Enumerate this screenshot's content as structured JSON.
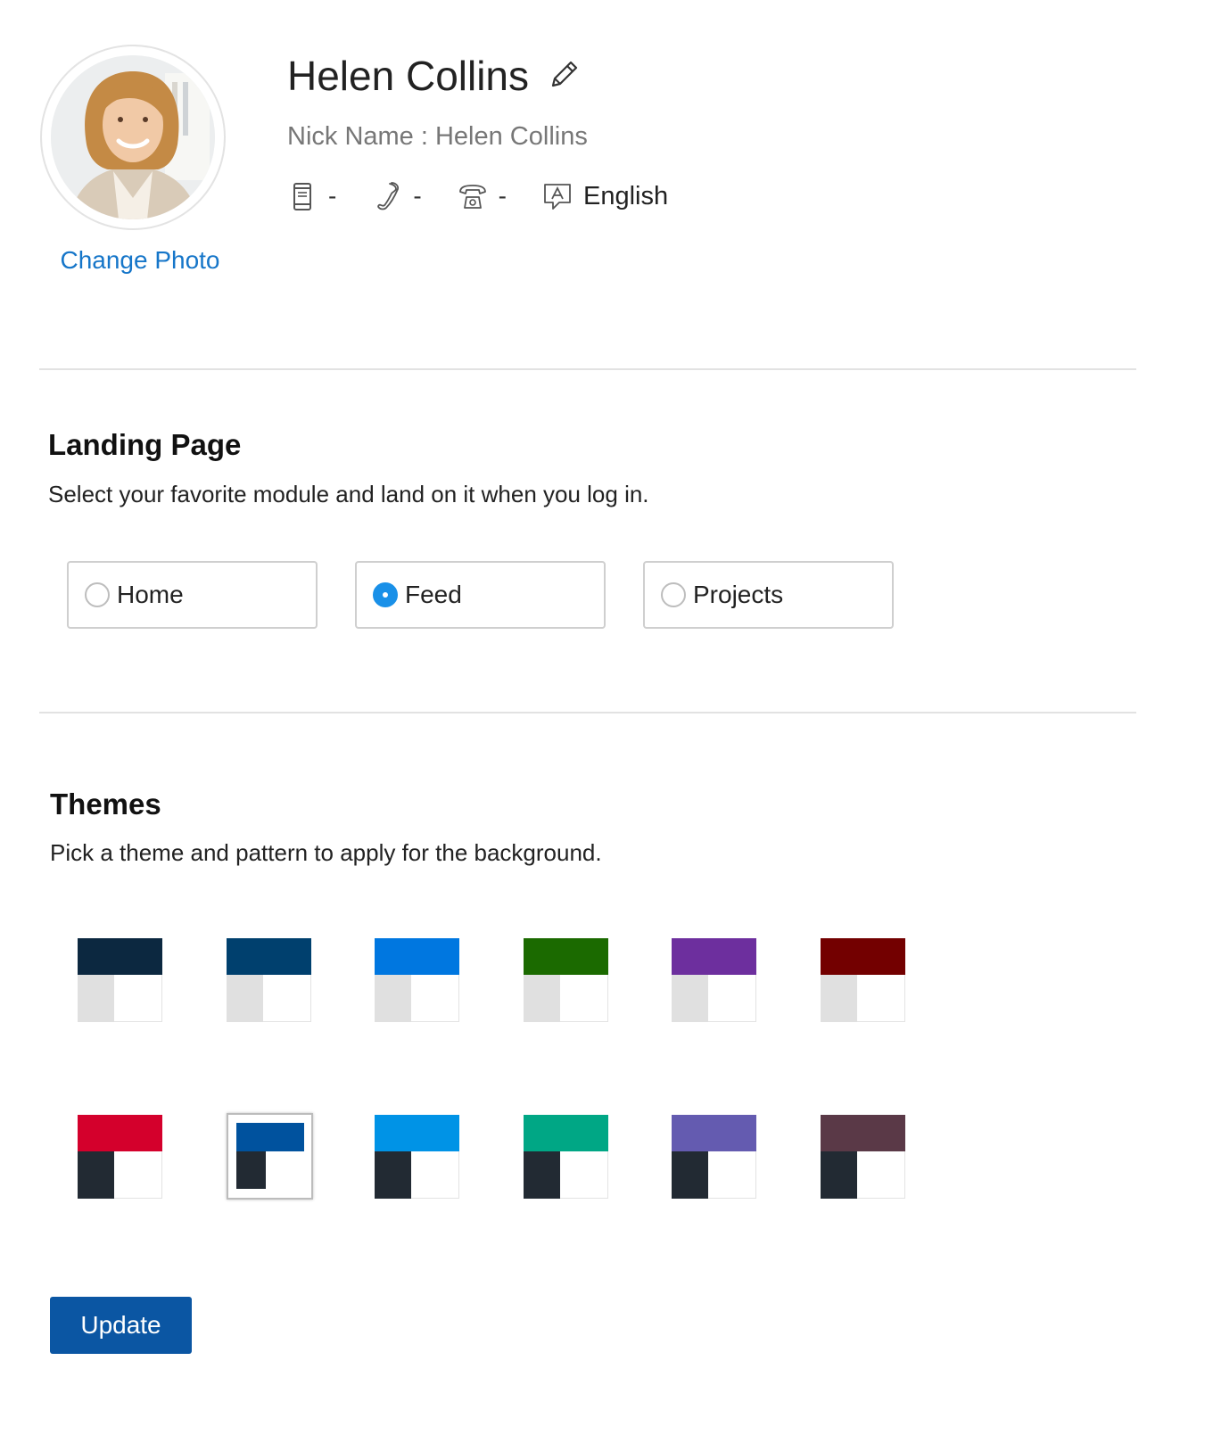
{
  "profile": {
    "name": "Helen Collins",
    "nickname_text": "Nick Name : Helen Collins",
    "change_photo": "Change Photo",
    "mobile": "-",
    "phone": "-",
    "landline": "-",
    "language": "English"
  },
  "landing": {
    "title": "Landing Page",
    "description": "Select your favorite module and land on it when you log in.",
    "options": [
      {
        "label": "Home",
        "selected": false
      },
      {
        "label": "Feed",
        "selected": true
      },
      {
        "label": "Projects",
        "selected": false
      }
    ]
  },
  "themes": {
    "title": "Themes",
    "description": "Pick a theme and pattern to apply for the background.",
    "light_pattern": [
      {
        "top": "#0c2840",
        "side": "#e0e0e0"
      },
      {
        "top": "#00406e",
        "side": "#e0e0e0"
      },
      {
        "top": "#0077e0",
        "side": "#e0e0e0"
      },
      {
        "top": "#1b6a00",
        "side": "#e0e0e0"
      },
      {
        "top": "#6d2f9e",
        "side": "#e0e0e0"
      },
      {
        "top": "#730000",
        "side": "#e0e0e0"
      }
    ],
    "dark_pattern": [
      {
        "top": "#d4002c",
        "side": "#222a33"
      },
      {
        "top": "#00529e",
        "side": "#222a33",
        "selected": true
      },
      {
        "top": "#0093e6",
        "side": "#222a33"
      },
      {
        "top": "#00a785",
        "side": "#222a33"
      },
      {
        "top": "#645bb0",
        "side": "#222a33"
      },
      {
        "top": "#5a3947",
        "side": "#222a33"
      }
    ]
  },
  "actions": {
    "update_label": "Update"
  },
  "colors": {
    "accent": "#1676c9",
    "button": "#0b56a3",
    "radio_checked": "#1990e8"
  }
}
